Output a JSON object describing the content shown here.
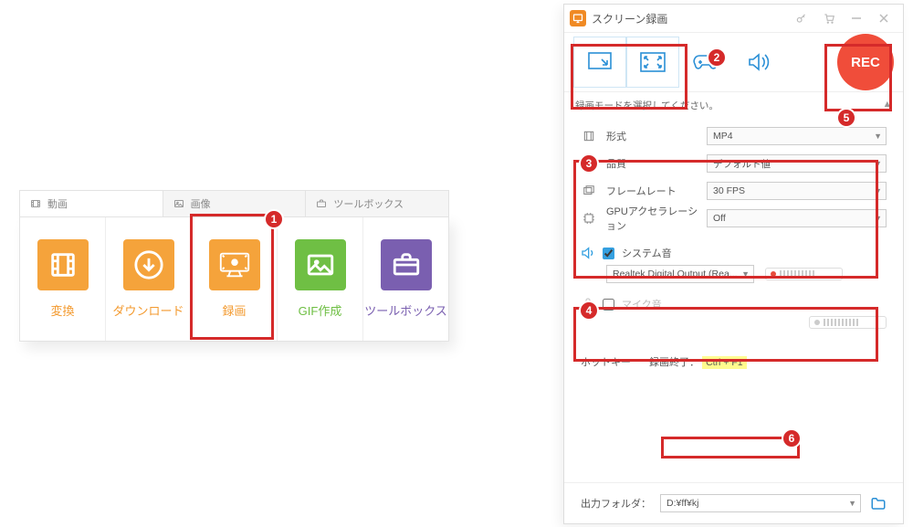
{
  "left": {
    "tabs": {
      "video": "動画",
      "image": "画像",
      "toolbox": "ツールボックス"
    },
    "tools": {
      "convert": "変換",
      "download": "ダウンロード",
      "record": "録画",
      "gif": "GIF作成",
      "toolbox": "ツールボックス"
    }
  },
  "app": {
    "title": "スクリーン録画",
    "hint": "録画モードを選択してください。",
    "rec": "REC",
    "settings": {
      "format": {
        "label": "形式",
        "value": "MP4"
      },
      "quality": {
        "label": "品質",
        "value": "デフォルト値"
      },
      "framerate": {
        "label": "フレームレート",
        "value": "30 FPS"
      },
      "gpu": {
        "label": "GPUアクセラレーション",
        "value": "Off"
      }
    },
    "audio": {
      "system_label": "システム音",
      "system_device": "Realtek Digital Output (Rea...",
      "mic_label": "マイク音"
    },
    "hotkey": {
      "label": "ホットキー",
      "stop_label": "録画終了：",
      "combo": "Ctrl + F1"
    },
    "output": {
      "label": "出力フォルダ：",
      "path": "D:¥ff¥kj"
    }
  },
  "callouts": {
    "c1": "1",
    "c2": "2",
    "c3": "3",
    "c4": "4",
    "c5": "5",
    "c6": "6"
  }
}
